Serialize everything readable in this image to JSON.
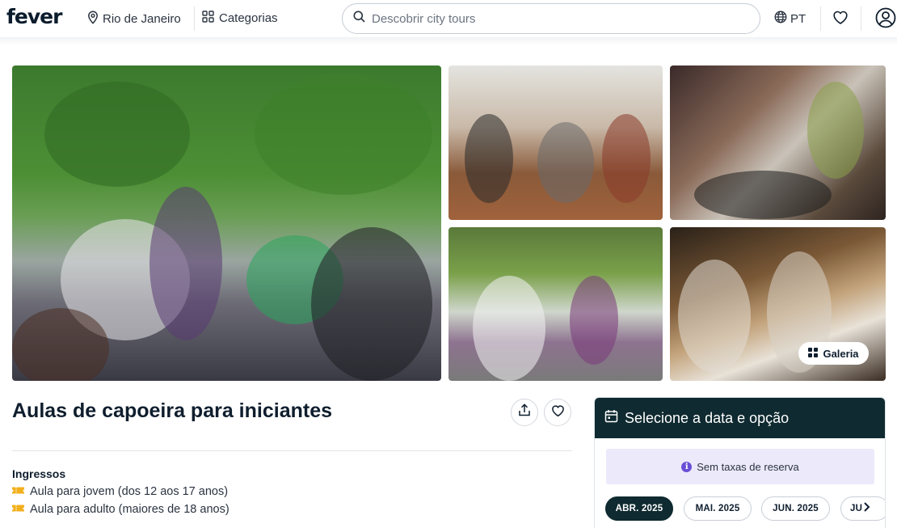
{
  "header": {
    "logo": "fever",
    "location": "Rio de Janeiro",
    "categories": "Categorias",
    "search_placeholder": "Descobrir city tours",
    "language": "PT"
  },
  "gallery": {
    "button_label": "Galeria"
  },
  "event": {
    "title": "Aulas de capoeira para iniciantes",
    "tickets_heading": "Ingressos",
    "tickets": [
      "Aula para jovem (dos 12 aos 17 anos)",
      "Aula para adulto (maiores de 18 anos)"
    ]
  },
  "booking": {
    "heading": "Selecione a data e opção",
    "notice": "Sem taxas de reserva",
    "months": [
      "ABR. 2025",
      "MAI. 2025",
      "JUN. 2025",
      "JU"
    ],
    "active_month": "ABR. 2025"
  },
  "colors": {
    "brand_dark": "#0f2a30",
    "notice_bg": "#ece9fb",
    "info_accent": "#6a4fd6",
    "ticket_icon": "#f2b01e"
  }
}
